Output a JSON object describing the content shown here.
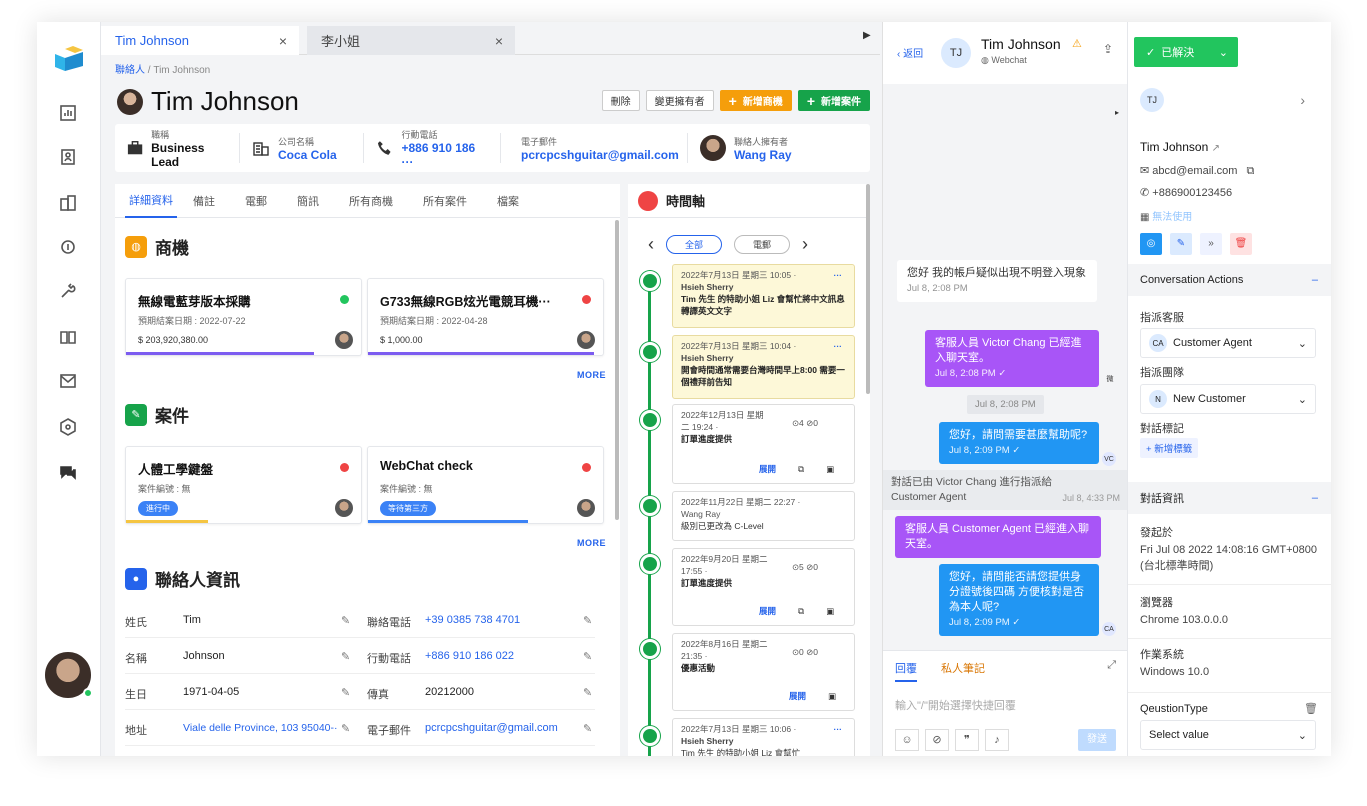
{
  "tabs": [
    {
      "label": "Tim Johnson"
    },
    {
      "label": "李小姐"
    }
  ],
  "tab_close": "×",
  "breadcrumb": {
    "root": "聯絡人",
    "sep": "/",
    "current": "Tim Johnson"
  },
  "contact": {
    "name": "Tim Johnson"
  },
  "actions": {
    "delete": "刪除",
    "change_owner": "變更擁有者",
    "new_deal": "新增商機",
    "new_case": "新增案件",
    "plus": "+"
  },
  "info": [
    {
      "label": "職稱",
      "value": "Business Lead",
      "icon": "briefcase-icon"
    },
    {
      "label": "公司名稱",
      "value": "Coca Cola",
      "icon": "building-icon"
    },
    {
      "label": "行動電話",
      "value": "+886 910 186 ···",
      "icon": "phone-icon"
    },
    {
      "label": "電子郵件",
      "value": "pcrcpcshguitar@gmail.com",
      "icon": "mail-icon"
    },
    {
      "label": "聯絡人擁有者",
      "value": "Wang Ray",
      "icon": "avatar"
    }
  ],
  "detail_tabs": [
    "詳細資料",
    "備註",
    "電郵",
    "簡訊",
    "所有商機",
    "所有案件",
    "檔案"
  ],
  "deals": {
    "title": "商機",
    "more": "MORE",
    "items": [
      {
        "title": "無線電藍芽版本採購",
        "date": "預期結案日期 : 2022-07-22",
        "amount": "$ 203,920,380.00",
        "status_color": "#22c55e",
        "progress": 0.8
      },
      {
        "title": "G733無線RGB炫光電競耳機···",
        "date": "預期結案日期 : 2022-04-28",
        "amount": "$ 1,000.00",
        "status_color": "#ef4444",
        "progress": 0.96
      }
    ]
  },
  "cases": {
    "title": "案件",
    "more": "MORE",
    "items": [
      {
        "title": "人體工學鍵盤",
        "sub": "案件編號 : 無",
        "pill": "進行中",
        "pill_color": "#3b82f6",
        "status_color": "#ef4444",
        "progress": 0.35,
        "bar_color": "#f5c542"
      },
      {
        "title": "WebChat check",
        "sub": "案件編號 : 無",
        "pill": "等待第三方",
        "pill_color": "#3b82f6",
        "status_color": "#ef4444",
        "progress": 0.68,
        "bar_color": "#3b82f6"
      }
    ]
  },
  "contact_info": {
    "title": "聯絡人資訊",
    "rows": [
      {
        "l1": "姓氏",
        "v1": "Tim",
        "l2": "聯絡電話",
        "v2": "+39 0385 738 4701"
      },
      {
        "l1": "名稱",
        "v1": "Johnson",
        "l2": "行動電話",
        "v2": "+886 910 186 022"
      },
      {
        "l1": "生日",
        "v1": "1971-04-05",
        "l2": "傳真",
        "v2": "20212000"
      },
      {
        "l1": "地址",
        "v1": "Viale delle Province, 103 95040-···",
        "l2": "電子郵件",
        "v2": "pcrcpcshguitar@gmail.com"
      }
    ]
  },
  "timeline": {
    "title": "時間軸",
    "filters": [
      "全部",
      "電郵"
    ],
    "items": [
      {
        "date": "2022年7月13日 星期三 10:05 ·",
        "author": "Hsieh Sherry",
        "body": "Tim 先生 的特助小姐 Liz 會幫忙將中文訊息轉譯英文文字",
        "dots": "···",
        "type": "yellow"
      },
      {
        "date": "2022年7月13日 星期三 10:04 ·",
        "author": "Hsieh Sherry",
        "body": "開會時間通常需要台灣時間早上8:00 需要一個禮拜前告知",
        "dots": "···",
        "type": "yellow"
      },
      {
        "date": "2022年12月13日 星期二 19:24 ·",
        "meta": "⊙4 ⊘0",
        "body": "訂單進度提供",
        "expand": "展開",
        "type": "mail"
      },
      {
        "date": "2022年11月22日 星期二 22:27 ·",
        "author": "Wang Ray",
        "body": "級別已更改為 C-Level",
        "type": "log"
      },
      {
        "date": "2022年9月20日 星期二 17:55 ·",
        "meta": "⊙5 ⊘0",
        "body": "訂單進度提供",
        "expand": "展開",
        "type": "mail"
      },
      {
        "date": "2022年8月16日 星期二 21:35 ·",
        "meta": "⊙0 ⊘0",
        "body": "優惠活動",
        "expand": "展開",
        "type": "mail"
      },
      {
        "date": "2022年7月13日 星期三 10:06 ·",
        "author": "Hsieh Sherry",
        "body": "Tim 先生 的特助小姐 Liz 會幫忙",
        "dots": "···",
        "type": "plain"
      }
    ]
  },
  "chat": {
    "back": "返回",
    "initials": "TJ",
    "name": "Tim Johnson",
    "channel": "Webchat",
    "resolved": "已解決",
    "messages": [
      {
        "text": "您好 我的帳戶疑似出現不明登入現象",
        "time": "Jul 8, 2:08 PM",
        "side": "left"
      },
      {
        "text": "客服人員 Victor Chang 已經進入聊天室。",
        "time": "Jul 8, 2:08 PM",
        "side": "purple",
        "av": "微"
      },
      {
        "text": "Jul 8, 2:08 PM",
        "side": "center"
      },
      {
        "text": "您好，請問需要甚麼幫助呢?",
        "time": "Jul 8, 2:09 PM",
        "side": "blue",
        "av": "VC"
      },
      {
        "text": "對話已由 Victor Chang 進行指派給 Customer Agent",
        "time": "Jul 8, 4:33 PM",
        "side": "system"
      },
      {
        "text": "客服人員 Customer Agent 已經進入聊天室。",
        "side": "purple"
      },
      {
        "text": "您好，請問能否請您提供身分證號後四碼 方便核對是否為本人呢?",
        "time": "Jul 8, 2:09 PM",
        "side": "blue",
        "av": "CA"
      }
    ],
    "reply_tab": "回覆",
    "note_tab": "私人筆記",
    "placeholder": "輸入\"/\"開始選擇快捷回覆",
    "send": "發送"
  },
  "side": {
    "initials": "TJ",
    "name": "Tim Johnson",
    "email": "abcd@email.com",
    "phone": "+886900123456",
    "unavailable": "無法使用",
    "conv_actions": "Conversation Actions",
    "assign_agent": "指派客服",
    "agent": "Customer Agent",
    "agent_initials": "CA",
    "assign_team": "指派團隊",
    "team": "New Customer",
    "team_initial": "N",
    "tags": "對話標記",
    "add_tag": "新增標籤",
    "conv_info": "對話資訊",
    "started": "發起於",
    "started_val": "Fri Jul 08 2022 14:08:16 GMT+0800 (台北標準時間)",
    "browser": "瀏覽器",
    "browser_val": "Chrome 103.0.0.0",
    "os": "作業系統",
    "os_val": "Windows 10.0",
    "qtype": "QeustionType",
    "select": "Select value",
    "minus": "–"
  }
}
